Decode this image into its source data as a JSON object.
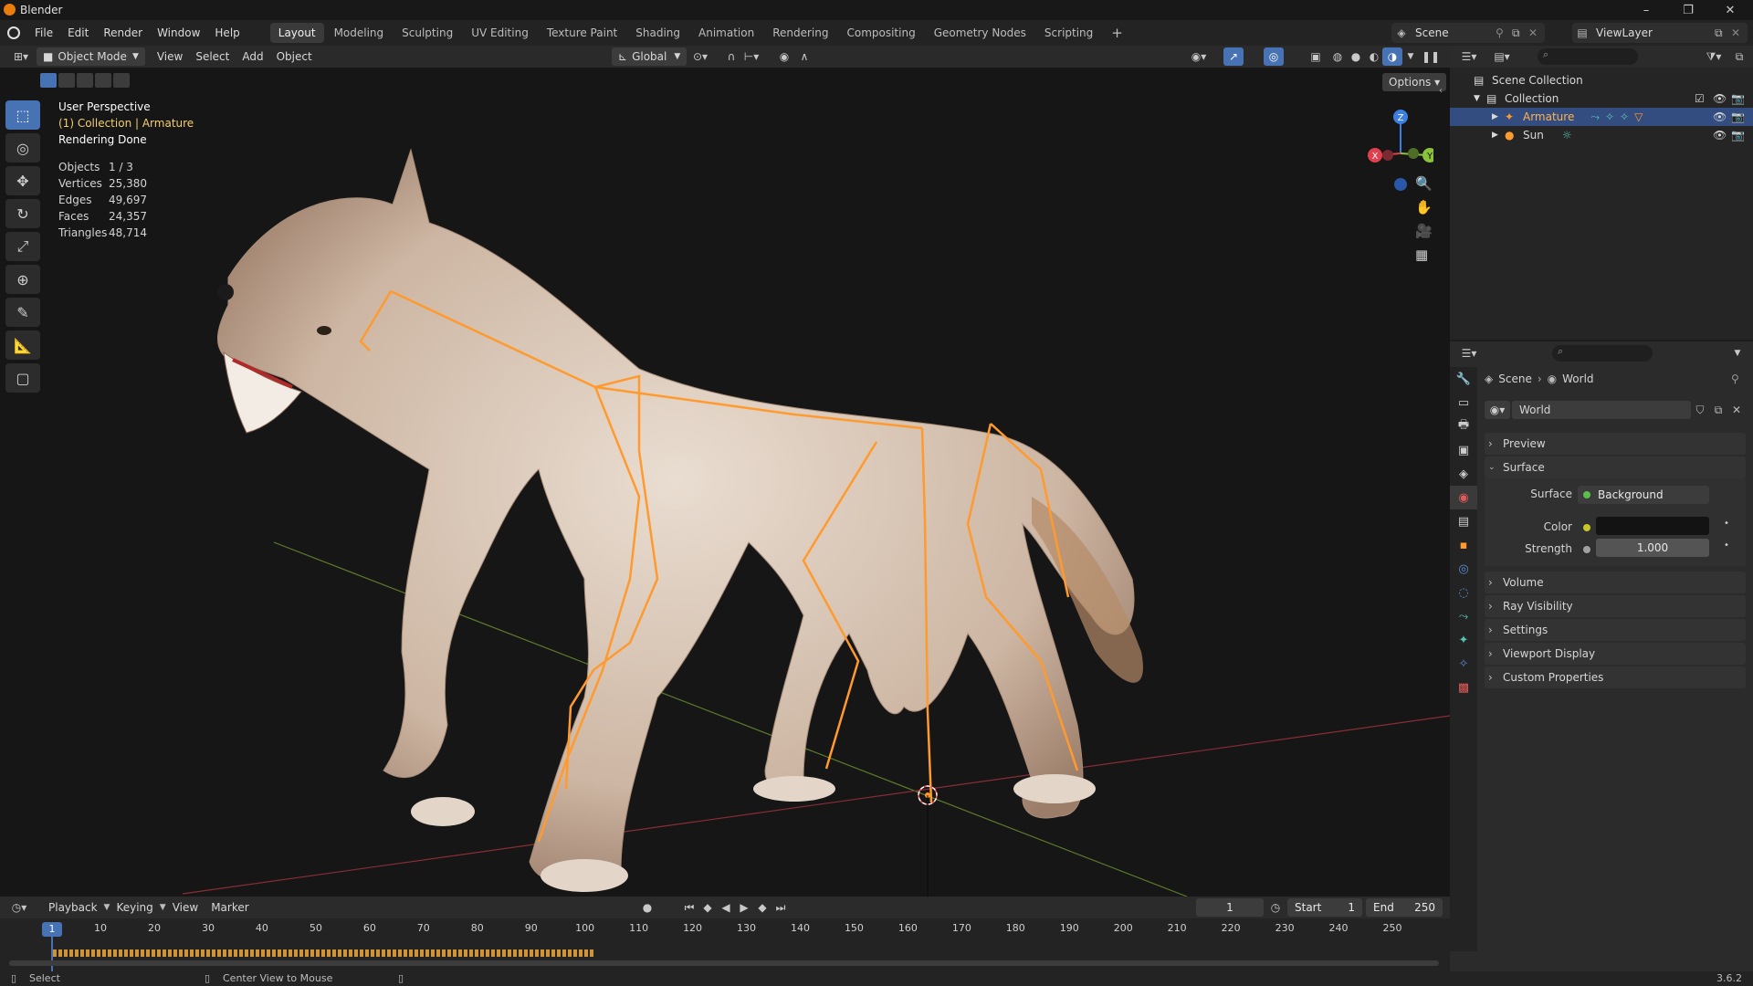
{
  "window": {
    "title": "Blender"
  },
  "menus": [
    "File",
    "Edit",
    "Render",
    "Window",
    "Help"
  ],
  "workspaces": [
    "Layout",
    "Modeling",
    "Sculpting",
    "UV Editing",
    "Texture Paint",
    "Shading",
    "Animation",
    "Rendering",
    "Compositing",
    "Geometry Nodes",
    "Scripting"
  ],
  "active_workspace": "Layout",
  "scene": {
    "name": "Scene",
    "view_layer": "ViewLayer"
  },
  "viewport_header": {
    "mode": "Object Mode",
    "menus": [
      "View",
      "Select",
      "Add",
      "Object"
    ],
    "orientation": "Global",
    "options": "Options"
  },
  "viewport": {
    "perspective": "User Perspective",
    "collection_line": "(1) Collection | Armature",
    "render_status": "Rendering Done",
    "stats": [
      {
        "label": "Objects",
        "value": "1 / 3"
      },
      {
        "label": "Vertices",
        "value": "25,380"
      },
      {
        "label": "Edges",
        "value": "49,697"
      },
      {
        "label": "Faces",
        "value": "24,357"
      },
      {
        "label": "Triangles",
        "value": "48,714"
      }
    ],
    "gizmo": {
      "z": "Z",
      "y": "Y",
      "x": "X"
    }
  },
  "outliner": {
    "root": "Scene Collection",
    "collection": "Collection",
    "items": [
      {
        "name": "Armature",
        "selected": true
      },
      {
        "name": "Sun",
        "selected": false
      }
    ]
  },
  "properties": {
    "breadcrumb": [
      "Scene",
      "World"
    ],
    "datablock": "World",
    "panels": [
      {
        "label": "Preview",
        "open": false
      },
      {
        "label": "Surface",
        "open": true
      },
      {
        "label": "Volume",
        "open": false
      },
      {
        "label": "Ray Visibility",
        "open": false
      },
      {
        "label": "Settings",
        "open": false
      },
      {
        "label": "Viewport Display",
        "open": false
      },
      {
        "label": "Custom Properties",
        "open": false
      }
    ],
    "surface": {
      "surface_label": "Surface",
      "surface_value": "Background",
      "color_label": "Color",
      "strength_label": "Strength",
      "strength_value": "1.000"
    }
  },
  "timeline": {
    "menus": [
      "Playback",
      "Keying",
      "View",
      "Marker"
    ],
    "current_frame": "1",
    "start_label": "Start",
    "start": "1",
    "end_label": "End",
    "end": "250",
    "ticks": [
      "1",
      "10",
      "20",
      "30",
      "40",
      "50",
      "60",
      "70",
      "80",
      "90",
      "100",
      "110",
      "120",
      "130",
      "140",
      "150",
      "160",
      "170",
      "180",
      "190",
      "200",
      "210",
      "220",
      "230",
      "240",
      "250"
    ]
  },
  "statusbar": {
    "left": "Select",
    "middle": "Center View to Mouse",
    "version": "3.6.2"
  },
  "colors": {
    "accent": "#4772b3",
    "bone": "#ff9a2e",
    "x_axis": "#e0404e",
    "y_axis": "#8ac23a",
    "z_axis": "#3c7fe0"
  }
}
